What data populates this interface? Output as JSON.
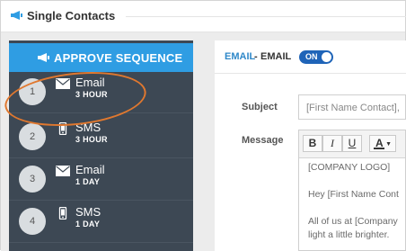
{
  "page": {
    "title": "Single Contacts"
  },
  "sidebar": {
    "approve_label": "APPROVE SEQUENCE",
    "steps": [
      {
        "number": "1",
        "type": "Email",
        "duration": "3 HOUR",
        "icon": "envelope-icon"
      },
      {
        "number": "2",
        "type": "SMS",
        "duration": "3 HOUR",
        "icon": "phone-icon"
      },
      {
        "number": "3",
        "type": "Email",
        "duration": "1 DAY",
        "icon": "envelope-icon"
      },
      {
        "number": "4",
        "type": "SMS",
        "duration": "1 DAY",
        "icon": "phone-icon"
      }
    ]
  },
  "panel": {
    "channel_type": "EMAIL",
    "separator": "-",
    "channel_name": "EMAIL",
    "toggle_label": "ON",
    "subject_label": "Subject",
    "subject_value": "[First Name Contact],",
    "message_label": "Message",
    "toolbar": {
      "bold": "B",
      "italic": "I",
      "underline": "U",
      "font_color": "A"
    },
    "body_lines": [
      "[COMPANY LOGO]",
      "Hey [First Name Cont",
      "All of us at [Company",
      "light a little brighter."
    ]
  },
  "colors": {
    "accent_blue": "#2f9de3",
    "sidebar_dark": "#3d4854",
    "highlight_orange": "#e0782f",
    "toggle_blue": "#1f64b8"
  }
}
